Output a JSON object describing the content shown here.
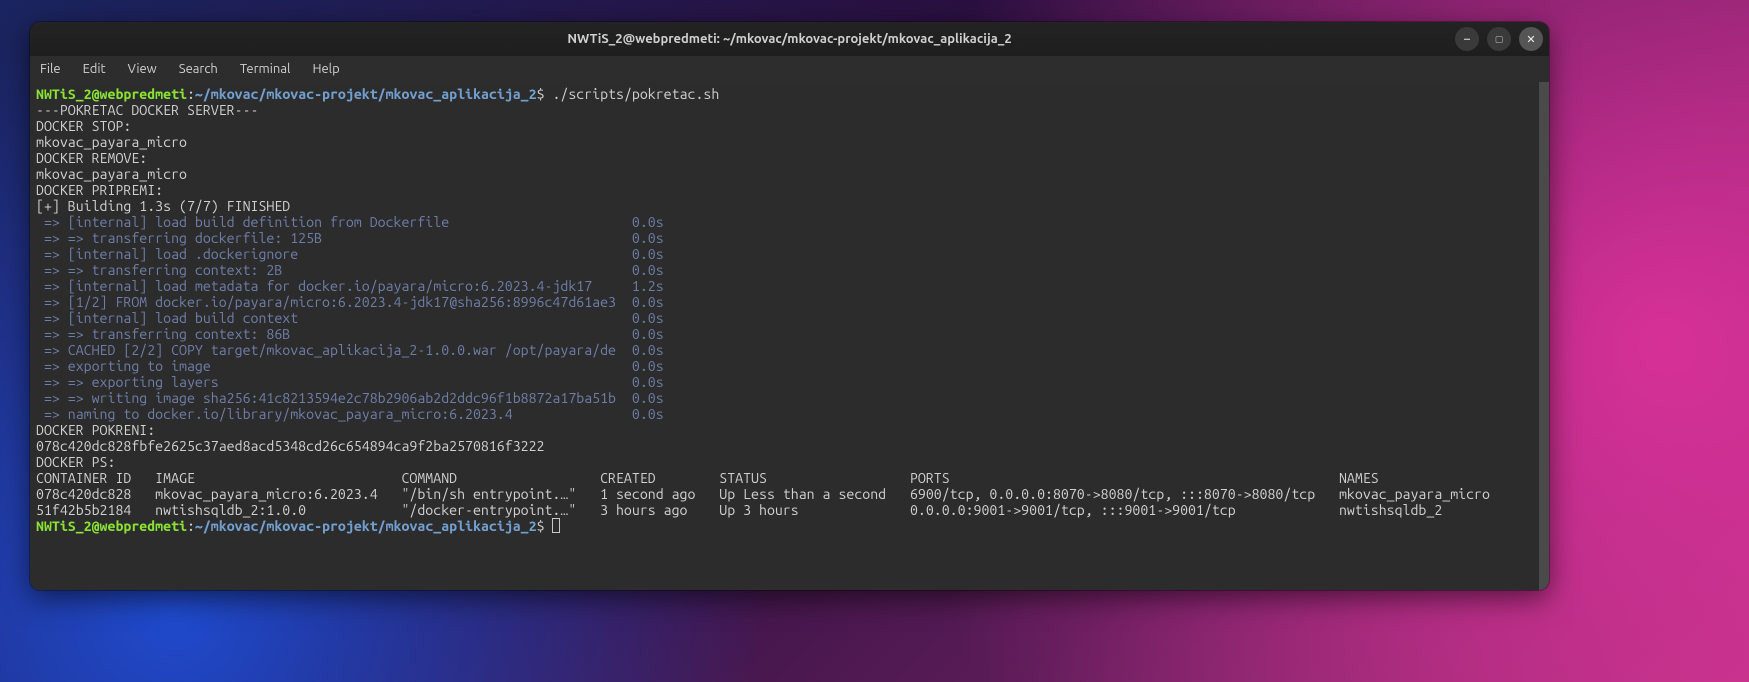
{
  "title": "NWTiS_2@webpredmeti: ~/mkovac/mkovac-projekt/mkovac_aplikacija_2",
  "menu": {
    "file": "File",
    "edit": "Edit",
    "view": "View",
    "search": "Search",
    "terminal": "Terminal",
    "help": "Help"
  },
  "prompt": {
    "user": "NWTiS_2@webpredmeti",
    "sep": ":",
    "path": "~/mkovac/mkovac-projekt/mkovac_aplikacija_2",
    "sign": "$ "
  },
  "cmd1": "./scripts/pokretac.sh",
  "script_out": [
    "---POKRETAC DOCKER SERVER---",
    "DOCKER STOP:",
    "mkovac_payara_micro",
    "DOCKER REMOVE:",
    "mkovac_payara_micro",
    "DOCKER PRIPREMI:",
    "[+] Building 1.3s (7/7) FINISHED"
  ],
  "build_lines": [
    {
      "t": " => [internal] load build definition from Dockerfile",
      "s": "0.0s"
    },
    {
      "t": " => => transferring dockerfile: 125B",
      "s": "0.0s"
    },
    {
      "t": " => [internal] load .dockerignore",
      "s": "0.0s"
    },
    {
      "t": " => => transferring context: 2B",
      "s": "0.0s"
    },
    {
      "t": " => [internal] load metadata for docker.io/payara/micro:6.2023.4-jdk17",
      "s": "1.2s"
    },
    {
      "t": " => [1/2] FROM docker.io/payara/micro:6.2023.4-jdk17@sha256:8996c47d61ae3",
      "s": "0.0s"
    },
    {
      "t": " => [internal] load build context",
      "s": "0.0s"
    },
    {
      "t": " => => transferring context: 86B",
      "s": "0.0s"
    },
    {
      "t": " => CACHED [2/2] COPY target/mkovac_aplikacija_2-1.0.0.war /opt/payara/de",
      "s": "0.0s"
    },
    {
      "t": " => exporting to image",
      "s": "0.0s"
    },
    {
      "t": " => => exporting layers",
      "s": "0.0s"
    },
    {
      "t": " => => writing image sha256:41c8213594e2c78b2906ab2d2ddc96f1b8872a17ba51b",
      "s": "0.0s"
    },
    {
      "t": " => naming to docker.io/library/mkovac_payara_micro:6.2023.4",
      "s": "0.0s"
    }
  ],
  "after_build": [
    "DOCKER POKRENI:",
    "078c420dc828fbfe2625c37aed8acd5348cd26c654894ca9f2ba2570816f3222",
    "DOCKER PS:"
  ],
  "ps_header": {
    "cid": "CONTAINER ID",
    "img": "IMAGE",
    "cmd": "COMMAND",
    "crt": "CREATED",
    "sts": "STATUS",
    "prt": "PORTS",
    "nms": "NAMES"
  },
  "ps_rows": [
    {
      "cid": "078c420dc828",
      "img": "mkovac_payara_micro:6.2023.4",
      "cmd": "\"/bin/sh entrypoint.…\"",
      "crt": "1 second ago",
      "sts": "Up Less than a second",
      "prt": "6900/tcp, 0.0.0.0:8070->8080/tcp, :::8070->8080/tcp",
      "nms": "mkovac_payara_micro"
    },
    {
      "cid": "51f42b5b2184",
      "img": "nwtishsqldb_2:1.0.0",
      "cmd": "\"/docker-entrypoint.…\"",
      "crt": "3 hours ago",
      "sts": "Up 3 hours",
      "prt": "0.0.0.0:9001->9001/tcp, :::9001->9001/tcp",
      "nms": "nwtishsqldb_2"
    }
  ],
  "cols": {
    "cid": 15,
    "img": 31,
    "cmd": 25,
    "crt": 15,
    "sts": 24,
    "prt": 54,
    "nms": 0
  }
}
